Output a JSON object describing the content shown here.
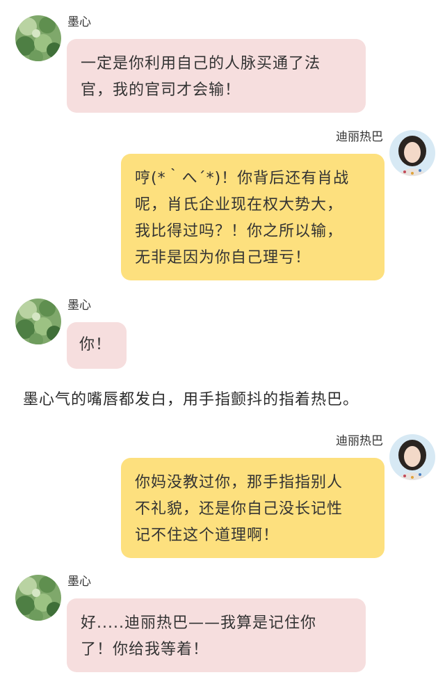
{
  "chat": {
    "messages": [
      {
        "sender": "墨心",
        "side": "left",
        "lines": [
          "一定是你利用自己的人脉买通了法",
          "官，我的官司才会输！"
        ]
      },
      {
        "sender": "迪丽热巴",
        "side": "right",
        "lines": [
          "哼(*｀へ´*)！你背后还有肖战",
          "呢，肖氏企业现在权大势大，",
          "我比得过吗？！你之所以输，",
          "无非是因为你自己理亏！"
        ]
      },
      {
        "sender": "墨心",
        "side": "left",
        "lines": [
          "你！"
        ]
      },
      {
        "sender": "迪丽热巴",
        "side": "right",
        "lines": [
          "你妈没教过你，那手指指别人",
          "不礼貌，还是你自己没长记性",
          "记不住这个道理啊！"
        ]
      },
      {
        "sender": "墨心",
        "side": "left",
        "lines": [
          "好.....迪丽热巴——我算是记住你",
          "了！你给我等着！"
        ]
      }
    ],
    "narration": "墨心气的嘴唇都发白，用手指颤抖的指着热巴。"
  },
  "colors": {
    "left_bubble": "#f6dede",
    "right_bubble": "#fde07e",
    "text": "#333333"
  },
  "icons": {
    "left_avatar": "green-leaves-avatar-icon",
    "right_avatar": "woman-portrait-avatar-icon"
  }
}
